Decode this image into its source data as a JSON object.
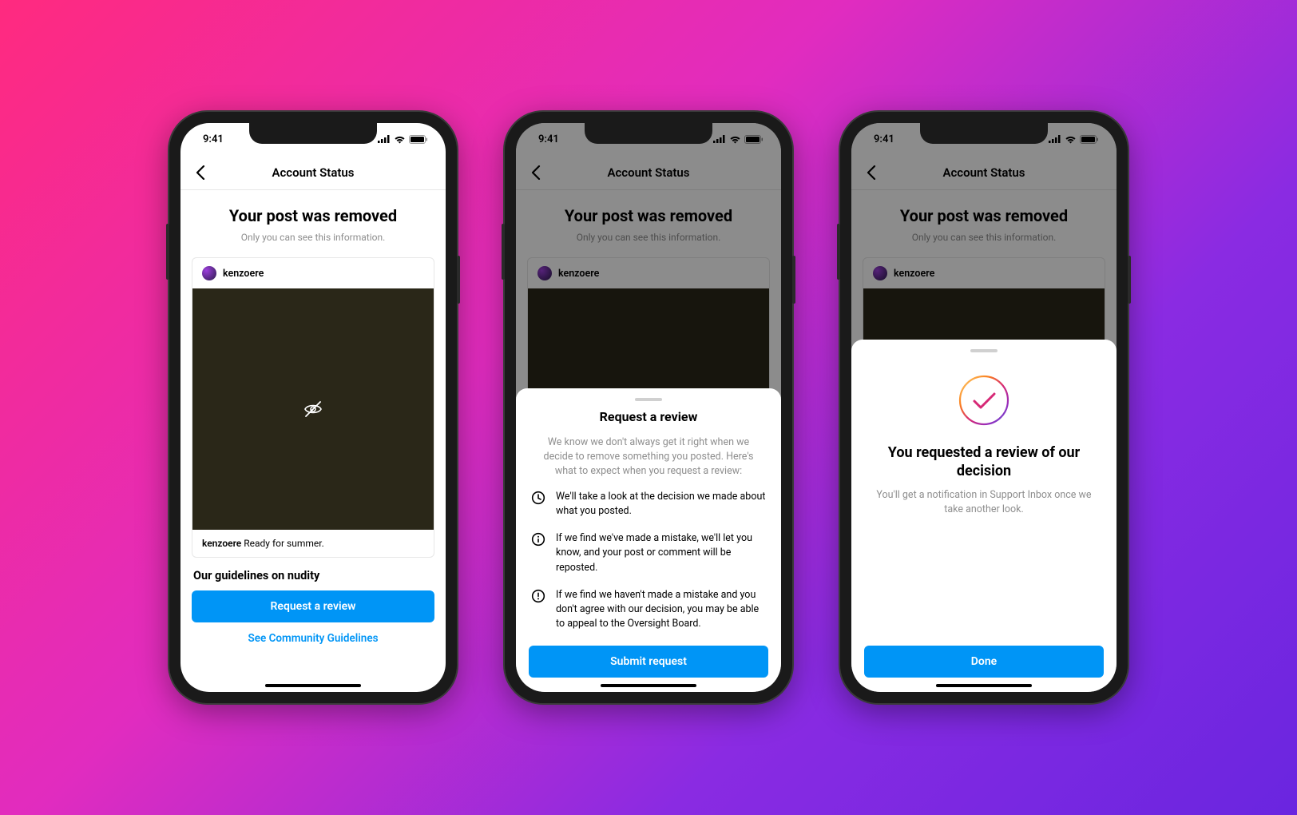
{
  "status": {
    "time": "9:41"
  },
  "nav": {
    "title": "Account Status"
  },
  "main": {
    "heading": "Your post was removed",
    "subtext": "Only you can see this information.",
    "post": {
      "username": "kenzoere",
      "caption_user": "kenzoere",
      "caption_text": " Ready for summer."
    },
    "guidelines_heading": "Our guidelines on nudity",
    "request_button": "Request a review",
    "community_link": "See Community Guidelines"
  },
  "sheet_review": {
    "title": "Request a review",
    "intro": "We know we don't always get it right when we decide to remove something you posted. Here's what to expect when you request a review:",
    "items": [
      "We'll take a look at the decision we made about what you posted.",
      "If we find we've made a mistake, we'll let you know, and your post or comment will be reposted.",
      "If we find we haven't made a mistake and you don't agree with our decision, you may be able to appeal to the Oversight Board."
    ],
    "submit": "Submit request"
  },
  "sheet_confirm": {
    "title": "You requested a review of our decision",
    "text": "You'll get a notification in Support Inbox once we take another look.",
    "done": "Done"
  }
}
